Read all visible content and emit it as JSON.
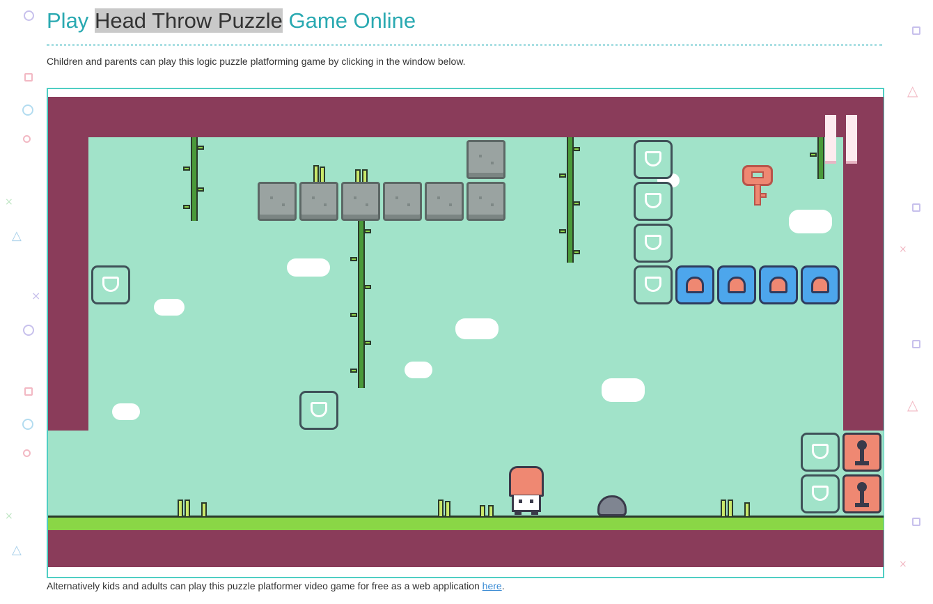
{
  "title": {
    "prefix": "Play",
    "highlight": "Head Throw Puzzle",
    "suffix": "Game Online"
  },
  "intro": "Children and parents can play this logic puzzle platforming game by clicking in the window below.",
  "outro": {
    "text": "Alternatively kids and adults can play this puzzle platformer video game for free as a web application",
    "link_label": "here",
    "end": "."
  },
  "colors": {
    "title": "#29a9b1",
    "frame_border": "#4fcec3",
    "game_background": "#a1e3c9",
    "wall": "#8a3c5a",
    "ground": "#8ad646",
    "stone_block": "#9aa3a1",
    "blue_block": "#4da6ec",
    "key": "#ef8872",
    "lock_block": "#ef8872",
    "player_head": "#ef8872"
  },
  "game": {
    "pause_icon": "pause-icon",
    "key_icon": "key-icon",
    "player_icon": "player-character",
    "rock_icon": "rock-icon"
  }
}
